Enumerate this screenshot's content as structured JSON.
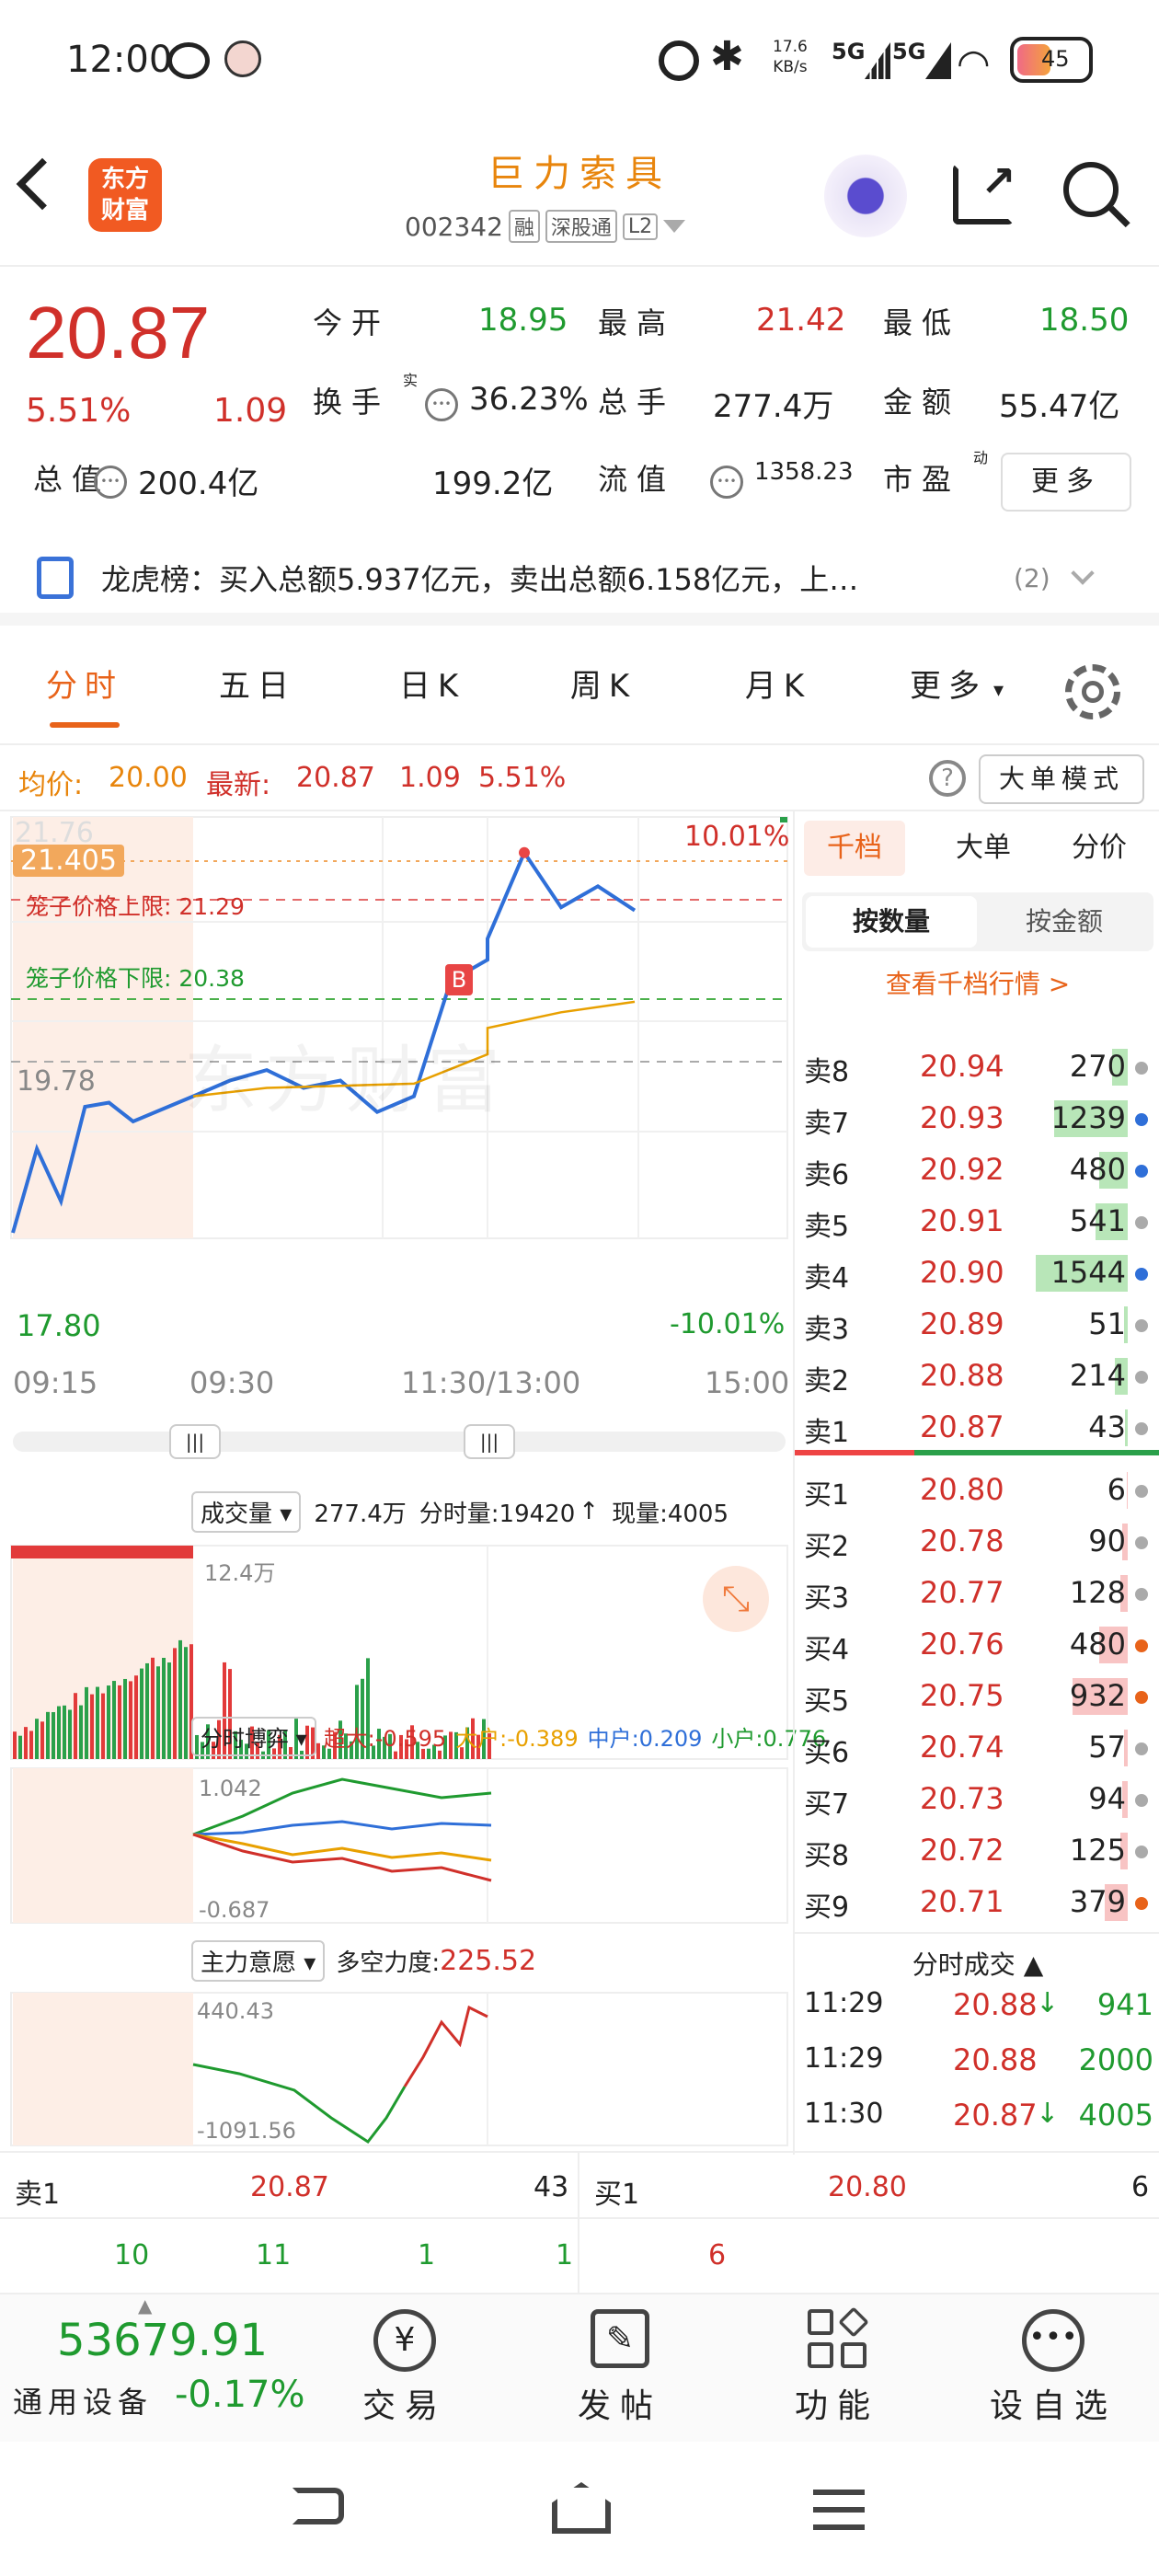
{
  "status_bar": {
    "time": "12:00",
    "net_speed_1": "17.6",
    "net_speed_2": "KB/s",
    "sig1": "5G",
    "sig2": "5G",
    "battery": "45"
  },
  "header": {
    "brand_line1": "东方",
    "brand_line2": "财富",
    "stock_name": "巨力索具",
    "stock_code": "002342",
    "tags": [
      "融",
      "深股通",
      "L2"
    ]
  },
  "quote": {
    "price": "20.87",
    "change_pct": "5.51%",
    "change": "1.09",
    "fields": [
      {
        "label": "今开",
        "value": "18.95",
        "color": "green"
      },
      {
        "label": "最高",
        "value": "21.42",
        "color": "red"
      },
      {
        "label": "最低",
        "value": "18.50",
        "color": "green"
      },
      {
        "label": "换手",
        "sup": "实",
        "value": "36.23%",
        "color": "dark"
      },
      {
        "label": "总手",
        "value": "277.4万",
        "color": "dark"
      },
      {
        "label": "金额",
        "value": "55.47亿",
        "color": "dark"
      },
      {
        "label": "总值",
        "value": "200.4亿",
        "color": "dark"
      },
      {
        "label": "流值",
        "value": "199.2亿",
        "color": "dark"
      },
      {
        "label": "市盈",
        "sup": "动",
        "value": "1358.23",
        "color": "dark"
      }
    ],
    "more_button": "更多"
  },
  "notice": {
    "text": "龙虎榜：买入总额5.937亿元，卖出总额6.158亿元，上…",
    "count": "(2)"
  },
  "tabs": [
    "分时",
    "五日",
    "日K",
    "周K",
    "月K",
    "更多"
  ],
  "info_bar": {
    "avg_label": "均价:",
    "avg": "20.00",
    "latest_label": "最新:",
    "latest": "20.87",
    "chg": "1.09",
    "pct": "5.51%",
    "mode_button": "大单模式"
  },
  "chart": {
    "top_pct": "10.01%",
    "bot_pct": "-10.01%",
    "y_top": "21.76",
    "y_mid": "19.78",
    "y_bot": "17.80",
    "crosshair": "21.405",
    "upper_limit": "笼子价格上限: 21.29",
    "lower_limit": "笼子价格下限: 20.38",
    "marker": "B",
    "watermark": "东方财富",
    "times": [
      "09:15",
      "09:30",
      "11:30/13:00",
      "15:00"
    ]
  },
  "volume": {
    "selector": "成交量",
    "total": "277.4万",
    "tick_label": "分时量:19420",
    "now_label": "现量:4005",
    "max": "12.4万"
  },
  "game": {
    "selector": "分时博弈",
    "items": [
      {
        "label": "超大:-0.595",
        "color": "#d0302a"
      },
      {
        "label": "大户:-0.389",
        "color": "#e8a000"
      },
      {
        "label": "中户:0.209",
        "color": "#2f6fd8"
      },
      {
        "label": "小户:0.776",
        "color": "#1f9a2f"
      }
    ],
    "max": "1.042",
    "min": "-0.687"
  },
  "intent": {
    "selector": "主力意愿",
    "label": "多空力度:",
    "value": "225.52",
    "max": "440.43",
    "min": "-1091.56"
  },
  "orderbook": {
    "tabs": [
      "千档",
      "大单",
      "分价"
    ],
    "toggle": [
      "按数量",
      "按金额"
    ],
    "link": "查看千档行情 >",
    "asks": [
      {
        "label": "卖8",
        "price": "20.94",
        "vol": "270",
        "bar": 0.17,
        "dot": "gray"
      },
      {
        "label": "卖7",
        "price": "20.93",
        "vol": "1239",
        "bar": 0.8,
        "dot": "blue"
      },
      {
        "label": "卖6",
        "price": "20.92",
        "vol": "480",
        "bar": 0.31,
        "dot": "blue"
      },
      {
        "label": "卖5",
        "price": "20.91",
        "vol": "541",
        "bar": 0.35,
        "dot": "gray"
      },
      {
        "label": "卖4",
        "price": "20.90",
        "vol": "1544",
        "bar": 1.0,
        "dot": "blue"
      },
      {
        "label": "卖3",
        "price": "20.89",
        "vol": "51",
        "bar": 0.04,
        "dot": "gray"
      },
      {
        "label": "卖2",
        "price": "20.88",
        "vol": "214",
        "bar": 0.14,
        "dot": "gray"
      },
      {
        "label": "卖1",
        "price": "20.87",
        "vol": "43",
        "bar": 0.03,
        "dot": "gray"
      }
    ],
    "bids": [
      {
        "label": "买1",
        "price": "20.80",
        "vol": "6",
        "bar": 0.01,
        "dot": "gray"
      },
      {
        "label": "买2",
        "price": "20.78",
        "vol": "90",
        "bar": 0.06,
        "dot": "gray"
      },
      {
        "label": "买3",
        "price": "20.77",
        "vol": "128",
        "bar": 0.08,
        "dot": "gray"
      },
      {
        "label": "买4",
        "price": "20.76",
        "vol": "480",
        "bar": 0.31,
        "dot": "orange"
      },
      {
        "label": "买5",
        "price": "20.75",
        "vol": "932",
        "bar": 0.6,
        "dot": "orange"
      },
      {
        "label": "买6",
        "price": "20.74",
        "vol": "57",
        "bar": 0.04,
        "dot": "gray"
      },
      {
        "label": "买7",
        "price": "20.73",
        "vol": "94",
        "bar": 0.06,
        "dot": "gray"
      },
      {
        "label": "买8",
        "price": "20.72",
        "vol": "125",
        "bar": 0.08,
        "dot": "gray"
      },
      {
        "label": "买9",
        "price": "20.71",
        "vol": "379",
        "bar": 0.25,
        "dot": "orange"
      }
    ],
    "trades_title": "分时成交",
    "trades": [
      {
        "time": "11:29",
        "price": "20.88",
        "arrow": "↓",
        "vol": "941"
      },
      {
        "time": "11:29",
        "price": "20.88",
        "arrow": "",
        "vol": "2000"
      },
      {
        "time": "11:30",
        "price": "20.87",
        "arrow": "↓",
        "vol": "4005"
      }
    ]
  },
  "queue": {
    "sell_label": "卖1",
    "sell_price": "20.87",
    "sell_vol": "43",
    "sell_orders": [
      "10",
      "11",
      "1",
      "1"
    ],
    "buy_label": "买1",
    "buy_price": "20.80",
    "buy_vol": "6",
    "buy_orders": [
      "6"
    ]
  },
  "bottom_nav": {
    "index_value": "53679.91",
    "index_name": "通用设备",
    "index_pct": "-0.17%",
    "items": [
      "交易",
      "发帖",
      "功能",
      "设自选"
    ]
  },
  "chart_data": [
    {
      "type": "line",
      "series": [
        {
          "x": [
            "09:15",
            "09:17",
            "09:19",
            "09:21",
            "09:23",
            "09:25",
            "09:30",
            "09:45",
            "10:00",
            "10:15",
            "10:30",
            "10:45",
            "11:00",
            "11:15",
            "11:30",
            "13:00",
            "13:15",
            "13:30",
            "13:45",
            "14:00"
          ],
          "values": [
            17.8,
            18.6,
            18.1,
            19.0,
            19.04,
            18.86,
            19.1,
            19.25,
            19.35,
            19.18,
            19.25,
            18.95,
            19.1,
            20.2,
            20.4,
            20.6,
            21.42,
            20.9,
            21.1,
            20.87
          ]
        },
        {
          "x": [
            "09:30",
            "10:00",
            "10:30",
            "11:00",
            "11:30",
            "13:00",
            "13:30",
            "14:00"
          ],
          "values": [
            19.1,
            19.18,
            19.2,
            19.22,
            19.5,
            19.75,
            19.9,
            20.0
          ]
        }
      ],
      "ylim": [
        17.8,
        21.76
      ]
    }
  ]
}
